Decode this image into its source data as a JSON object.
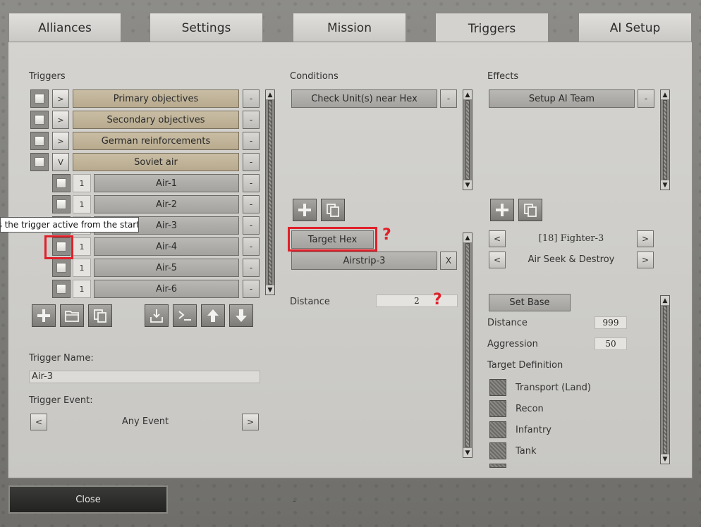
{
  "tabs": [
    "Alliances",
    "Settings",
    "Mission",
    "Triggers",
    "AI Setup"
  ],
  "triggers": {
    "header": "Triggers",
    "groups": [
      {
        "expand": ">",
        "label": "Primary objectives",
        "remove": "-"
      },
      {
        "expand": ">",
        "label": "Secondary objectives",
        "remove": "-"
      },
      {
        "expand": ">",
        "label": "German reinforcements",
        "remove": "-"
      },
      {
        "expand": "V",
        "label": "Soviet air",
        "remove": "-"
      }
    ],
    "children": [
      {
        "num": "1",
        "label": "Air-1",
        "remove": "-"
      },
      {
        "num": "1",
        "label": "Air-2",
        "remove": "-"
      },
      {
        "num": "1",
        "label": "Air-3",
        "remove": "-"
      },
      {
        "num": "1",
        "label": "Air-4",
        "remove": "-"
      },
      {
        "num": "1",
        "label": "Air-5",
        "remove": "-"
      },
      {
        "num": "1",
        "label": "Air-6",
        "remove": "-"
      }
    ],
    "tooltip": "Is the trigger active from the start?",
    "name_label": "Trigger Name:",
    "name_value": "Air-3",
    "event_label": "Trigger Event:",
    "event_value": "Any Event",
    "event_prev": "<",
    "event_next": ">"
  },
  "conditions": {
    "header": "Conditions",
    "items": [
      {
        "label": "Check Unit(s) near Hex",
        "remove": "-"
      }
    ],
    "target_hex": "Target Hex",
    "target_hex_mark": "?",
    "hex_value": "Airstrip-3",
    "hex_clear": "X",
    "distance_label": "Distance",
    "distance_value": "2",
    "distance_mark": "?"
  },
  "effects": {
    "header": "Effects",
    "items": [
      {
        "label": "Setup AI Team",
        "remove": "-"
      }
    ],
    "unit_prev": "<",
    "unit_value": "[18] Fighter-3",
    "unit_next": ">",
    "order_prev": "<",
    "order_value": "Air Seek & Destroy",
    "order_next": ">",
    "set_base": "Set Base",
    "distance_label": "Distance",
    "distance_value": "999",
    "aggression_label": "Aggression",
    "aggression_value": "50",
    "target_def_label": "Target Definition",
    "targets": [
      "Transport (Land)",
      "Recon",
      "Infantry",
      "Tank"
    ]
  },
  "footer": {
    "close": "Close",
    "marker": "-"
  }
}
